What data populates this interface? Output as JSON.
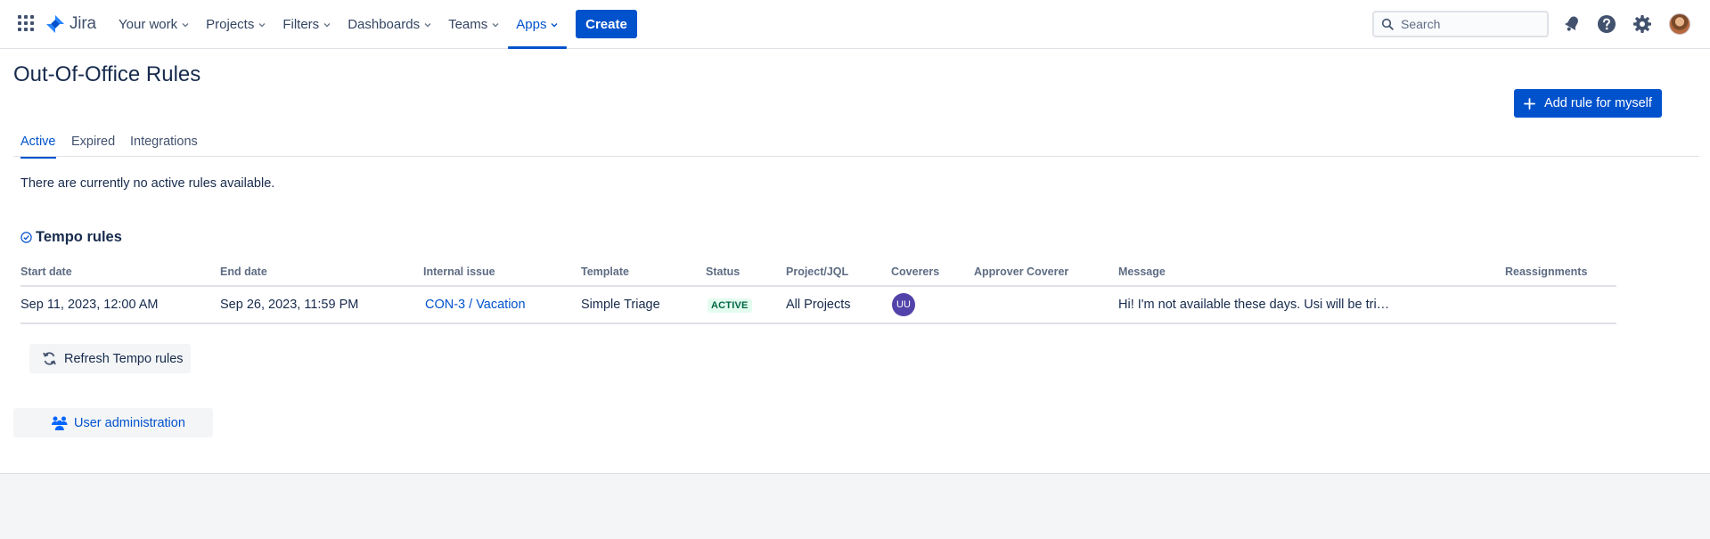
{
  "topnav": {
    "logo_text": "Jira",
    "items": [
      {
        "label": "Your work"
      },
      {
        "label": "Projects"
      },
      {
        "label": "Filters"
      },
      {
        "label": "Dashboards"
      },
      {
        "label": "Teams"
      },
      {
        "label": "Apps",
        "active": true
      }
    ],
    "create_label": "Create",
    "search_placeholder": "Search",
    "icons": [
      "app-switcher-icon",
      "notifications-icon",
      "help-icon",
      "settings-icon",
      "profile-avatar"
    ]
  },
  "page": {
    "title": "Out-Of-Office Rules",
    "add_rule_label": "Add rule for myself",
    "tabs": [
      {
        "label": "Active",
        "active": true
      },
      {
        "label": "Expired"
      },
      {
        "label": "Integrations"
      }
    ],
    "no_rules_text": "There are currently no active rules available."
  },
  "tempo": {
    "section_title": "Tempo rules",
    "columns": [
      "Start date",
      "End date",
      "Internal issue",
      "Template",
      "Status",
      "Project/JQL",
      "Coverers",
      "Approver Coverer",
      "Message",
      "Reassignments"
    ],
    "rows": [
      {
        "start_date": "Sep 11, 2023, 12:00 AM",
        "end_date": "Sep 26, 2023, 11:59 PM",
        "internal_issue": "CON-3 / Vacation",
        "template": "Simple Triage",
        "status": "ACTIVE",
        "project_jql": "All Projects",
        "coverer_initials": "UU",
        "approver_coverer": "",
        "message": "Hi! I'm not available these days. Usi will be tri…",
        "reassignments": ""
      }
    ],
    "refresh_label": "Refresh Tempo rules"
  },
  "user_admin_label": "User administration",
  "colors": {
    "brand_blue": "#0052cc",
    "text": "#172b4d",
    "status_green_text": "#006644",
    "status_green_bg": "#e3fcef",
    "coverer_avatar": "#5243aa"
  }
}
